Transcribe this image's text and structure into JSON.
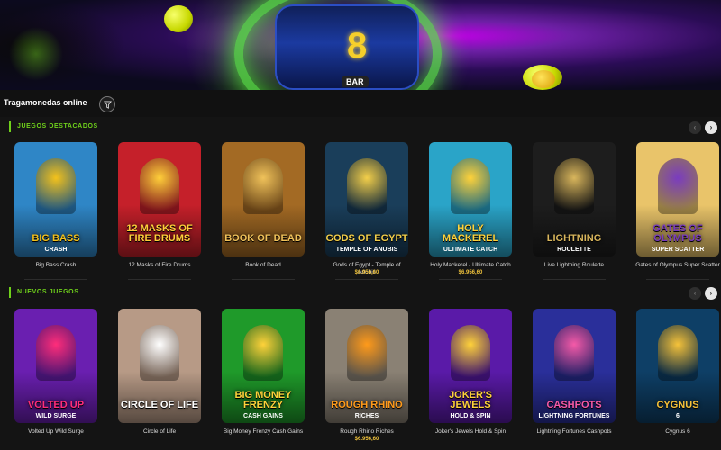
{
  "page": {
    "title": "Tragamonedas online",
    "hero": {
      "reel_symbol": "8",
      "reel_label": "BAR"
    },
    "filter_icon": "filter-icon"
  },
  "sections": [
    {
      "heading": "JUEGOS DESTACADOS",
      "games": [
        {
          "name": "Big Bass Crash",
          "art_title": "BIG BASS",
          "art_sub": "CRASH",
          "bg": "#2f86c6",
          "accent": "#f4c21b",
          "jackpot": ""
        },
        {
          "name": "12 Masks of Fire Drums",
          "art_title": "12 MASKS OF FIRE DRUMS",
          "art_sub": "",
          "bg": "#c5202a",
          "accent": "#ffcf3a",
          "jackpot": ""
        },
        {
          "name": "Book of Dead",
          "art_title": "BOOK OF DEAD",
          "art_sub": "",
          "bg": "#a36a24",
          "accent": "#f0c25a",
          "jackpot": ""
        },
        {
          "name": "Gods of Egypt - Temple of Anubis",
          "art_title": "GODS OF EGYPT",
          "art_sub": "TEMPLE OF ANUBIS",
          "bg": "#1a3e5a",
          "accent": "#f3cf4a",
          "jackpot": "$6.956,60"
        },
        {
          "name": "Holy Mackerel - Ultimate Catch",
          "art_title": "HOLY MACKEREL",
          "art_sub": "ULTIMATE CATCH",
          "bg": "#2aa4c8",
          "accent": "#ffd23a",
          "jackpot": "$6.956,60"
        },
        {
          "name": "Live Lightning Roulette",
          "art_title": "LIGHTNING",
          "art_sub": "ROULETTE",
          "bg": "#1d1d1d",
          "accent": "#d9b65c",
          "jackpot": ""
        },
        {
          "name": "Gates of Olympus Super Scatter",
          "art_title": "GATES OF OLYMPUS",
          "art_sub": "SUPER SCATTER",
          "bg": "#e9c46a",
          "accent": "#7a3cbf",
          "jackpot": ""
        }
      ]
    },
    {
      "heading": "NUEVOS JUEGOS",
      "games": [
        {
          "name": "Volted Up Wild Surge",
          "art_title": "VOLTED UP",
          "art_sub": "WILD SURGE",
          "bg": "#6a1fb0",
          "accent": "#ff2d7a",
          "jackpot": ""
        },
        {
          "name": "Circle of Life",
          "art_title": "CIRCLE OF LIFE",
          "art_sub": "",
          "bg": "#b79a86",
          "accent": "#ffffff",
          "jackpot": ""
        },
        {
          "name": "Big Money Frenzy Cash Gains",
          "art_title": "BIG MONEY FRENZY",
          "art_sub": "CASH GAINS",
          "bg": "#1f9a2a",
          "accent": "#ffd23a",
          "jackpot": ""
        },
        {
          "name": "Rough Rhino Riches",
          "art_title": "ROUGH RHINO",
          "art_sub": "RICHES",
          "bg": "#8a8174",
          "accent": "#ff9a1a",
          "jackpot": "$6.956,60"
        },
        {
          "name": "Joker's Jewels Hold & Spin",
          "art_title": "JOKER'S JEWELS",
          "art_sub": "HOLD & SPIN",
          "bg": "#5a1aa8",
          "accent": "#ffd23a",
          "jackpot": ""
        },
        {
          "name": "Lightning Fortunes Cashpots",
          "art_title": "CASHPOTS",
          "art_sub": "LIGHTNING FORTUNES",
          "bg": "#2a2f9a",
          "accent": "#f55aa8",
          "jackpot": ""
        },
        {
          "name": "Cygnus 6",
          "art_title": "CYGNUS",
          "art_sub": "6",
          "bg": "#0e3f66",
          "accent": "#f5c23a",
          "jackpot": ""
        }
      ]
    }
  ],
  "nav": {
    "prev_icon": "chevron-left-icon",
    "next_icon": "chevron-right-icon",
    "prev_glyph": "‹",
    "next_glyph": "›"
  }
}
